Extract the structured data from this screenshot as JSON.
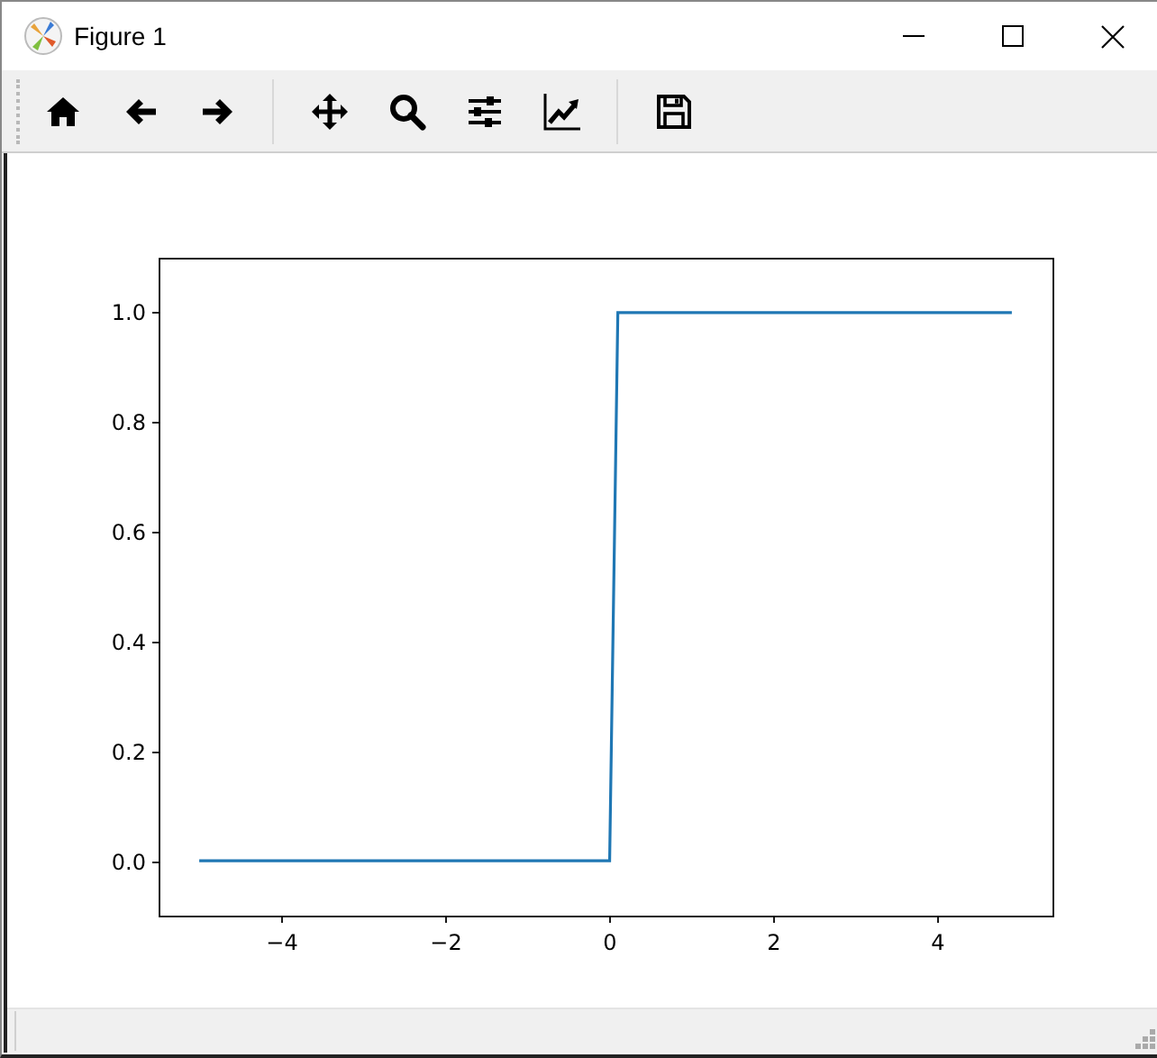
{
  "window": {
    "title": "Figure 1"
  },
  "figure": {
    "chart_data": {
      "type": "line",
      "x": [
        -5,
        0,
        0.1,
        4.9
      ],
      "series": [
        {
          "color": "#1f77b4",
          "values": [
            0,
            0,
            1,
            1
          ]
        }
      ],
      "xlim": [
        -5.495,
        5.395
      ],
      "ylim": [
        -0.1,
        1.1
      ],
      "xticks": [
        {
          "value": -4,
          "label": "−4"
        },
        {
          "value": -2,
          "label": "−2"
        },
        {
          "value": 0,
          "label": "0"
        },
        {
          "value": 2,
          "label": "2"
        },
        {
          "value": 4,
          "label": "4"
        }
      ],
      "yticks": [
        {
          "value": 0,
          "label": "0.0"
        },
        {
          "value": 0.2,
          "label": "0.2"
        },
        {
          "value": 0.4,
          "label": "0.4"
        },
        {
          "value": 0.6,
          "label": "0.6"
        },
        {
          "value": 0.8,
          "label": "0.8"
        },
        {
          "value": 1,
          "label": "1.0"
        }
      ]
    }
  }
}
